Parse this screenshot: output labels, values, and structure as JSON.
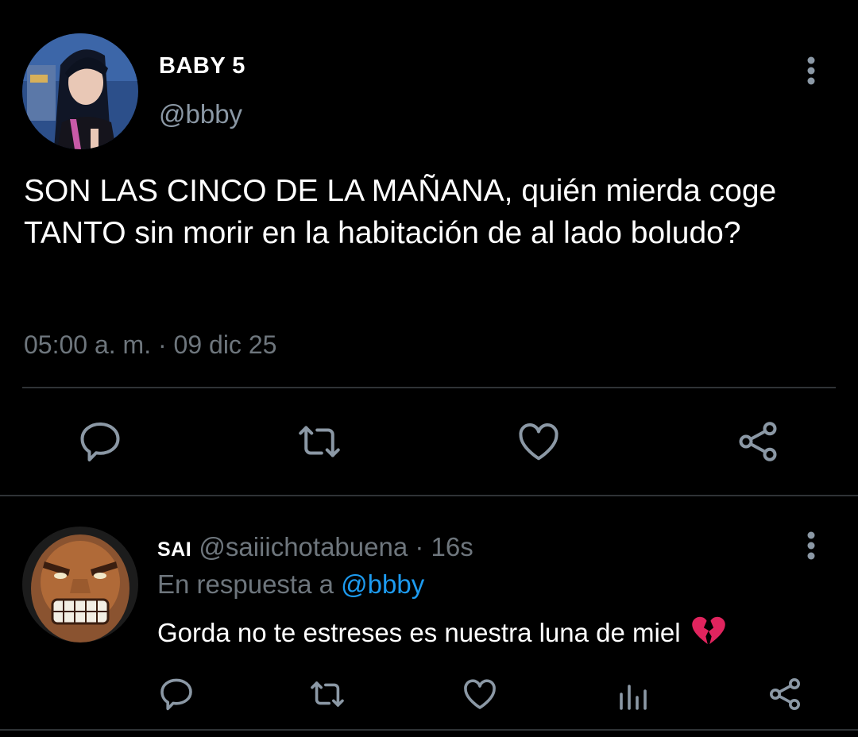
{
  "tweet": {
    "display_name": "BABY 5",
    "handle": "@bbby",
    "text": "SON LAS CINCO DE LA MAÑANA, quién mierda coge TANTO sin morir en la habitación de al lado boludo?",
    "time": "05:00 a. m.",
    "separator": "·",
    "date": "09 dic 25",
    "actions": [
      "reply-icon",
      "retweet-icon",
      "like-icon",
      "share-icon"
    ]
  },
  "reply": {
    "display_name": "SAI",
    "handle": "@saiiichotabuena",
    "separator": "·",
    "age": "16s",
    "replying_prefix": "En respuesta a",
    "replying_to": "@bbby",
    "text": "Gorda no te estreses es nuestra luna de miel",
    "emoji": "broken-heart-icon",
    "actions": [
      "reply-icon",
      "retweet-icon",
      "like-icon",
      "analytics-icon",
      "share-icon"
    ]
  },
  "colors": {
    "background": "#000000",
    "primary_text": "#ffffff",
    "secondary_text": "#6e767d",
    "icon": "#8b98a5",
    "link": "#1d9bf0",
    "divider": "#2f3336",
    "broken_heart": "#e0245e"
  }
}
